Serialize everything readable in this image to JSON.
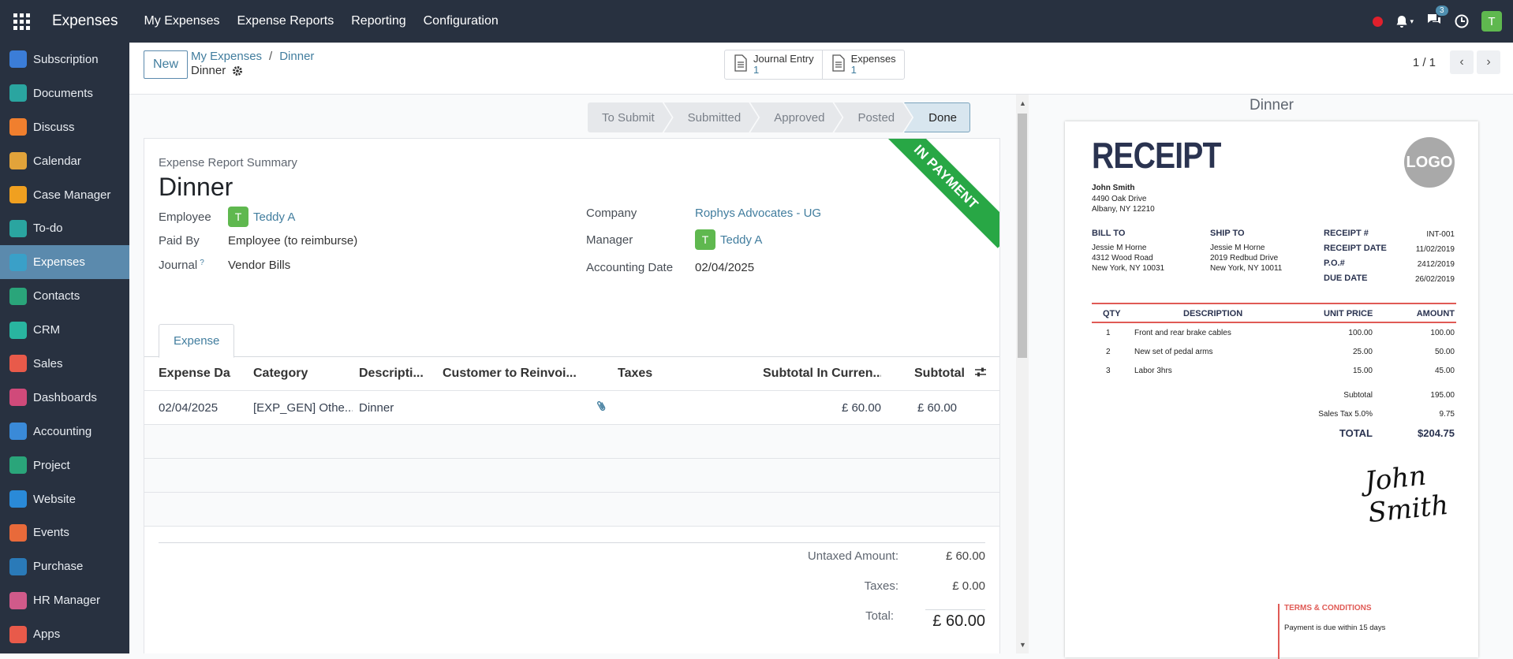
{
  "topbar": {
    "brand": "Expenses",
    "menu": [
      "My Expenses",
      "Expense Reports",
      "Reporting",
      "Configuration"
    ],
    "chat_count": "3",
    "user_initial": "T"
  },
  "sidebar": {
    "items": [
      {
        "label": "Subscription",
        "icon": "subscription-icon",
        "color": "#3b7dd8"
      },
      {
        "label": "Documents",
        "icon": "documents-icon",
        "color": "#2aa5a0"
      },
      {
        "label": "Discuss",
        "icon": "discuss-icon",
        "color": "#f07f2e"
      },
      {
        "label": "Calendar",
        "icon": "calendar-icon",
        "color": "#e2a33a"
      },
      {
        "label": "Case Manager",
        "icon": "case-manager-icon",
        "color": "#f0a020"
      },
      {
        "label": "To-do",
        "icon": "todo-icon",
        "color": "#2aa5a0"
      },
      {
        "label": "Expenses",
        "icon": "expenses-icon",
        "color": "#3aa0c8"
      },
      {
        "label": "Contacts",
        "icon": "contacts-icon",
        "color": "#2aa57a"
      },
      {
        "label": "CRM",
        "icon": "crm-icon",
        "color": "#29b5a0"
      },
      {
        "label": "Sales",
        "icon": "sales-icon",
        "color": "#e85a4a"
      },
      {
        "label": "Dashboards",
        "icon": "dashboards-icon",
        "color": "#d04a7a"
      },
      {
        "label": "Accounting",
        "icon": "accounting-icon",
        "color": "#3a8ad8"
      },
      {
        "label": "Project",
        "icon": "project-icon",
        "color": "#2aa57a"
      },
      {
        "label": "Website",
        "icon": "website-icon",
        "color": "#2a8ad8"
      },
      {
        "label": "Events",
        "icon": "events-icon",
        "color": "#e86a3a"
      },
      {
        "label": "Purchase",
        "icon": "purchase-icon",
        "color": "#2a7ab8"
      },
      {
        "label": "HR Manager",
        "icon": "hr-manager-icon",
        "color": "#d05a8a"
      },
      {
        "label": "Apps",
        "icon": "apps-icon",
        "color": "#e85a4a"
      }
    ],
    "active": "Expenses"
  },
  "control": {
    "new_label": "New",
    "breadcrumb_parent": "My Expenses",
    "breadcrumb_sep": "/",
    "breadcrumb_current": "Dinner",
    "record_name": "Dinner",
    "smart_buttons": [
      {
        "title": "Journal Entry",
        "count": "1"
      },
      {
        "title": "Expenses",
        "count": "1"
      }
    ],
    "pager": "1 / 1"
  },
  "status": {
    "stages": [
      "To Submit",
      "Submitted",
      "Approved",
      "Posted",
      "Done"
    ],
    "current": "Done"
  },
  "form": {
    "ribbon": "IN PAYMENT",
    "summary_label": "Expense Report Summary",
    "title": "Dinner",
    "employee_label": "Employee",
    "employee": "Teddy A",
    "employee_initial": "T",
    "paid_by_label": "Paid By",
    "paid_by": "Employee (to reimburse)",
    "journal_label": "Journal",
    "journal_help": "?",
    "journal": "Vendor Bills",
    "company_label": "Company",
    "company": "Rophys Advocates - UG",
    "manager_label": "Manager",
    "manager": "Teddy A",
    "manager_initial": "T",
    "acc_date_label": "Accounting Date",
    "acc_date": "02/04/2025",
    "tab": "Expense"
  },
  "table": {
    "headers": [
      "Expense Da...",
      "Category",
      "Descripti...",
      "Customer to Reinvoi...",
      "Taxes",
      "Subtotal In Curren...",
      "Subtotal"
    ],
    "row": {
      "date": "02/04/2025",
      "category": "[EXP_GEN] Othe...",
      "description": "Dinner",
      "customer": "",
      "taxes": "",
      "subtotal_currency": "£ 60.00",
      "subtotal": "£ 60.00"
    }
  },
  "totals": {
    "untaxed_label": "Untaxed Amount:",
    "untaxed": "£ 60.00",
    "taxes_label": "Taxes:",
    "taxes": "£ 0.00",
    "total_label": "Total:",
    "total": "£ 60.00"
  },
  "preview": {
    "title": "Dinner",
    "receipt": {
      "heading": "RECEIPT",
      "logo": "LOGO",
      "from_name": "John Smith",
      "from_addr1": "4490 Oak Drive",
      "from_addr2": "Albany, NY 12210",
      "bill_to": "BILL TO",
      "bill_name": "Jessie M Horne",
      "bill_addr1": "4312 Wood Road",
      "bill_addr2": "New York, NY 10031",
      "ship_to": "SHIP TO",
      "ship_name": "Jessie M Horne",
      "ship_addr1": "2019 Redbud Drive",
      "ship_addr2": "New York, NY 10011",
      "meta_labels": [
        "RECEIPT #",
        "RECEIPT DATE",
        "P.O.#",
        "DUE DATE"
      ],
      "meta_values": [
        "INT-001",
        "11/02/2019",
        "2412/2019",
        "26/02/2019"
      ],
      "cols": [
        "QTY",
        "DESCRIPTION",
        "UNIT PRICE",
        "AMOUNT"
      ],
      "lines": [
        {
          "qty": "1",
          "desc": "Front and rear brake cables",
          "price": "100.00",
          "amount": "100.00"
        },
        {
          "qty": "2",
          "desc": "New set of pedal arms",
          "price": "25.00",
          "amount": "50.00"
        },
        {
          "qty": "3",
          "desc": "Labor 3hrs",
          "price": "15.00",
          "amount": "45.00"
        }
      ],
      "subtotal_label": "Subtotal",
      "subtotal": "195.00",
      "tax_label": "Sales Tax 5.0%",
      "tax": "9.75",
      "total_label": "TOTAL",
      "total": "$204.75",
      "signature": "John Smith",
      "terms_title": "TERMS & CONDITIONS",
      "terms_text": "Payment is due within 15 days"
    }
  }
}
